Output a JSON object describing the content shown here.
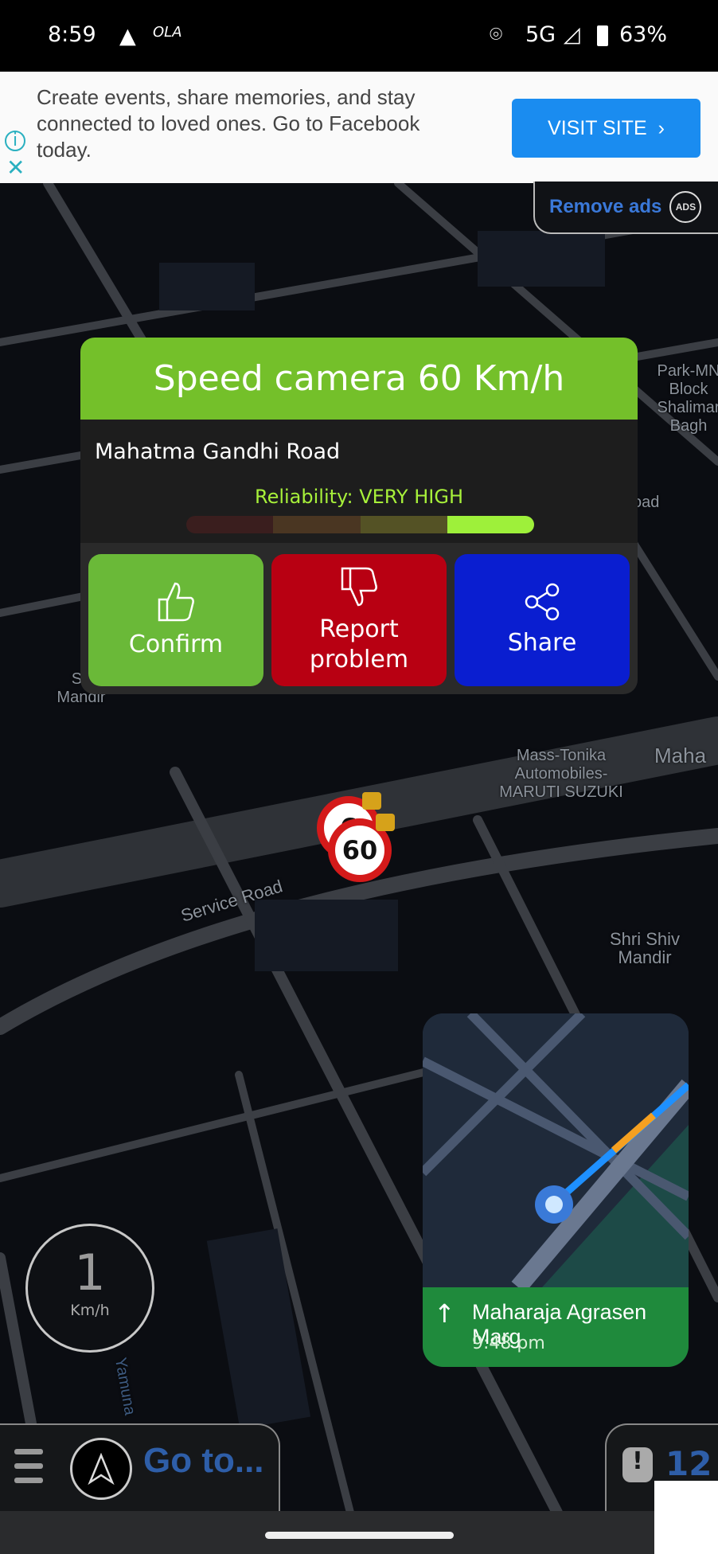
{
  "status_bar": {
    "time": "8:59",
    "network": "5G",
    "battery": "63%",
    "icons": [
      "navigation-arrow-icon",
      "ola-app-icon",
      "location-pin-icon",
      "signal-icon",
      "battery-icon"
    ]
  },
  "ad": {
    "text": "Create events, share memories, and stay connected to loved ones. Go to Facebook today.",
    "cta": "VISIT SITE",
    "info_icon": "info-icon",
    "close_icon": "close-icon"
  },
  "remove_ads": {
    "label": "Remove ads",
    "icon_text": "ADS"
  },
  "popup": {
    "title": "Speed camera 60 Km/h",
    "road": "Mahatma Gandhi Road",
    "reliability": "Reliability: VERY HIGH",
    "reliability_level": 4,
    "reliability_max": 4,
    "reliability_colors": [
      "#3a1e1e",
      "#4a3622",
      "#545225",
      "#9ef03a"
    ],
    "buttons": [
      {
        "label": "Confirm",
        "icon": "thumbs-up-icon",
        "color": "#6ab938"
      },
      {
        "label": "Report problem",
        "icon": "thumbs-down-icon",
        "color": "#b80012"
      },
      {
        "label": "Share",
        "icon": "share-icon",
        "color": "#0a1ed0"
      }
    ]
  },
  "map_labels": {
    "park": "Park-MN Block Shalimar Bagh",
    "road_partial": "oad",
    "mandir_partial": "Sh Mandir",
    "mass": "Mass-Tonika Automobiles- MARUTI SUZUKI",
    "maha": "Maha",
    "service": "Service Road",
    "shiv": "Shri Shiv Mandir",
    "yamuna": "Yamuna",
    "block": "Block"
  },
  "speed_cameras": [
    {
      "limit": "6"
    },
    {
      "limit": "60"
    }
  ],
  "mini_nav": {
    "street": "Maharaja Agrasen Marg",
    "eta": "9:48 pm",
    "direction_icon": "arrow-up-icon"
  },
  "speedometer": {
    "value": "1",
    "unit": "Km/h"
  },
  "bottom": {
    "goto": "Go to...",
    "alerts_count": "12"
  }
}
